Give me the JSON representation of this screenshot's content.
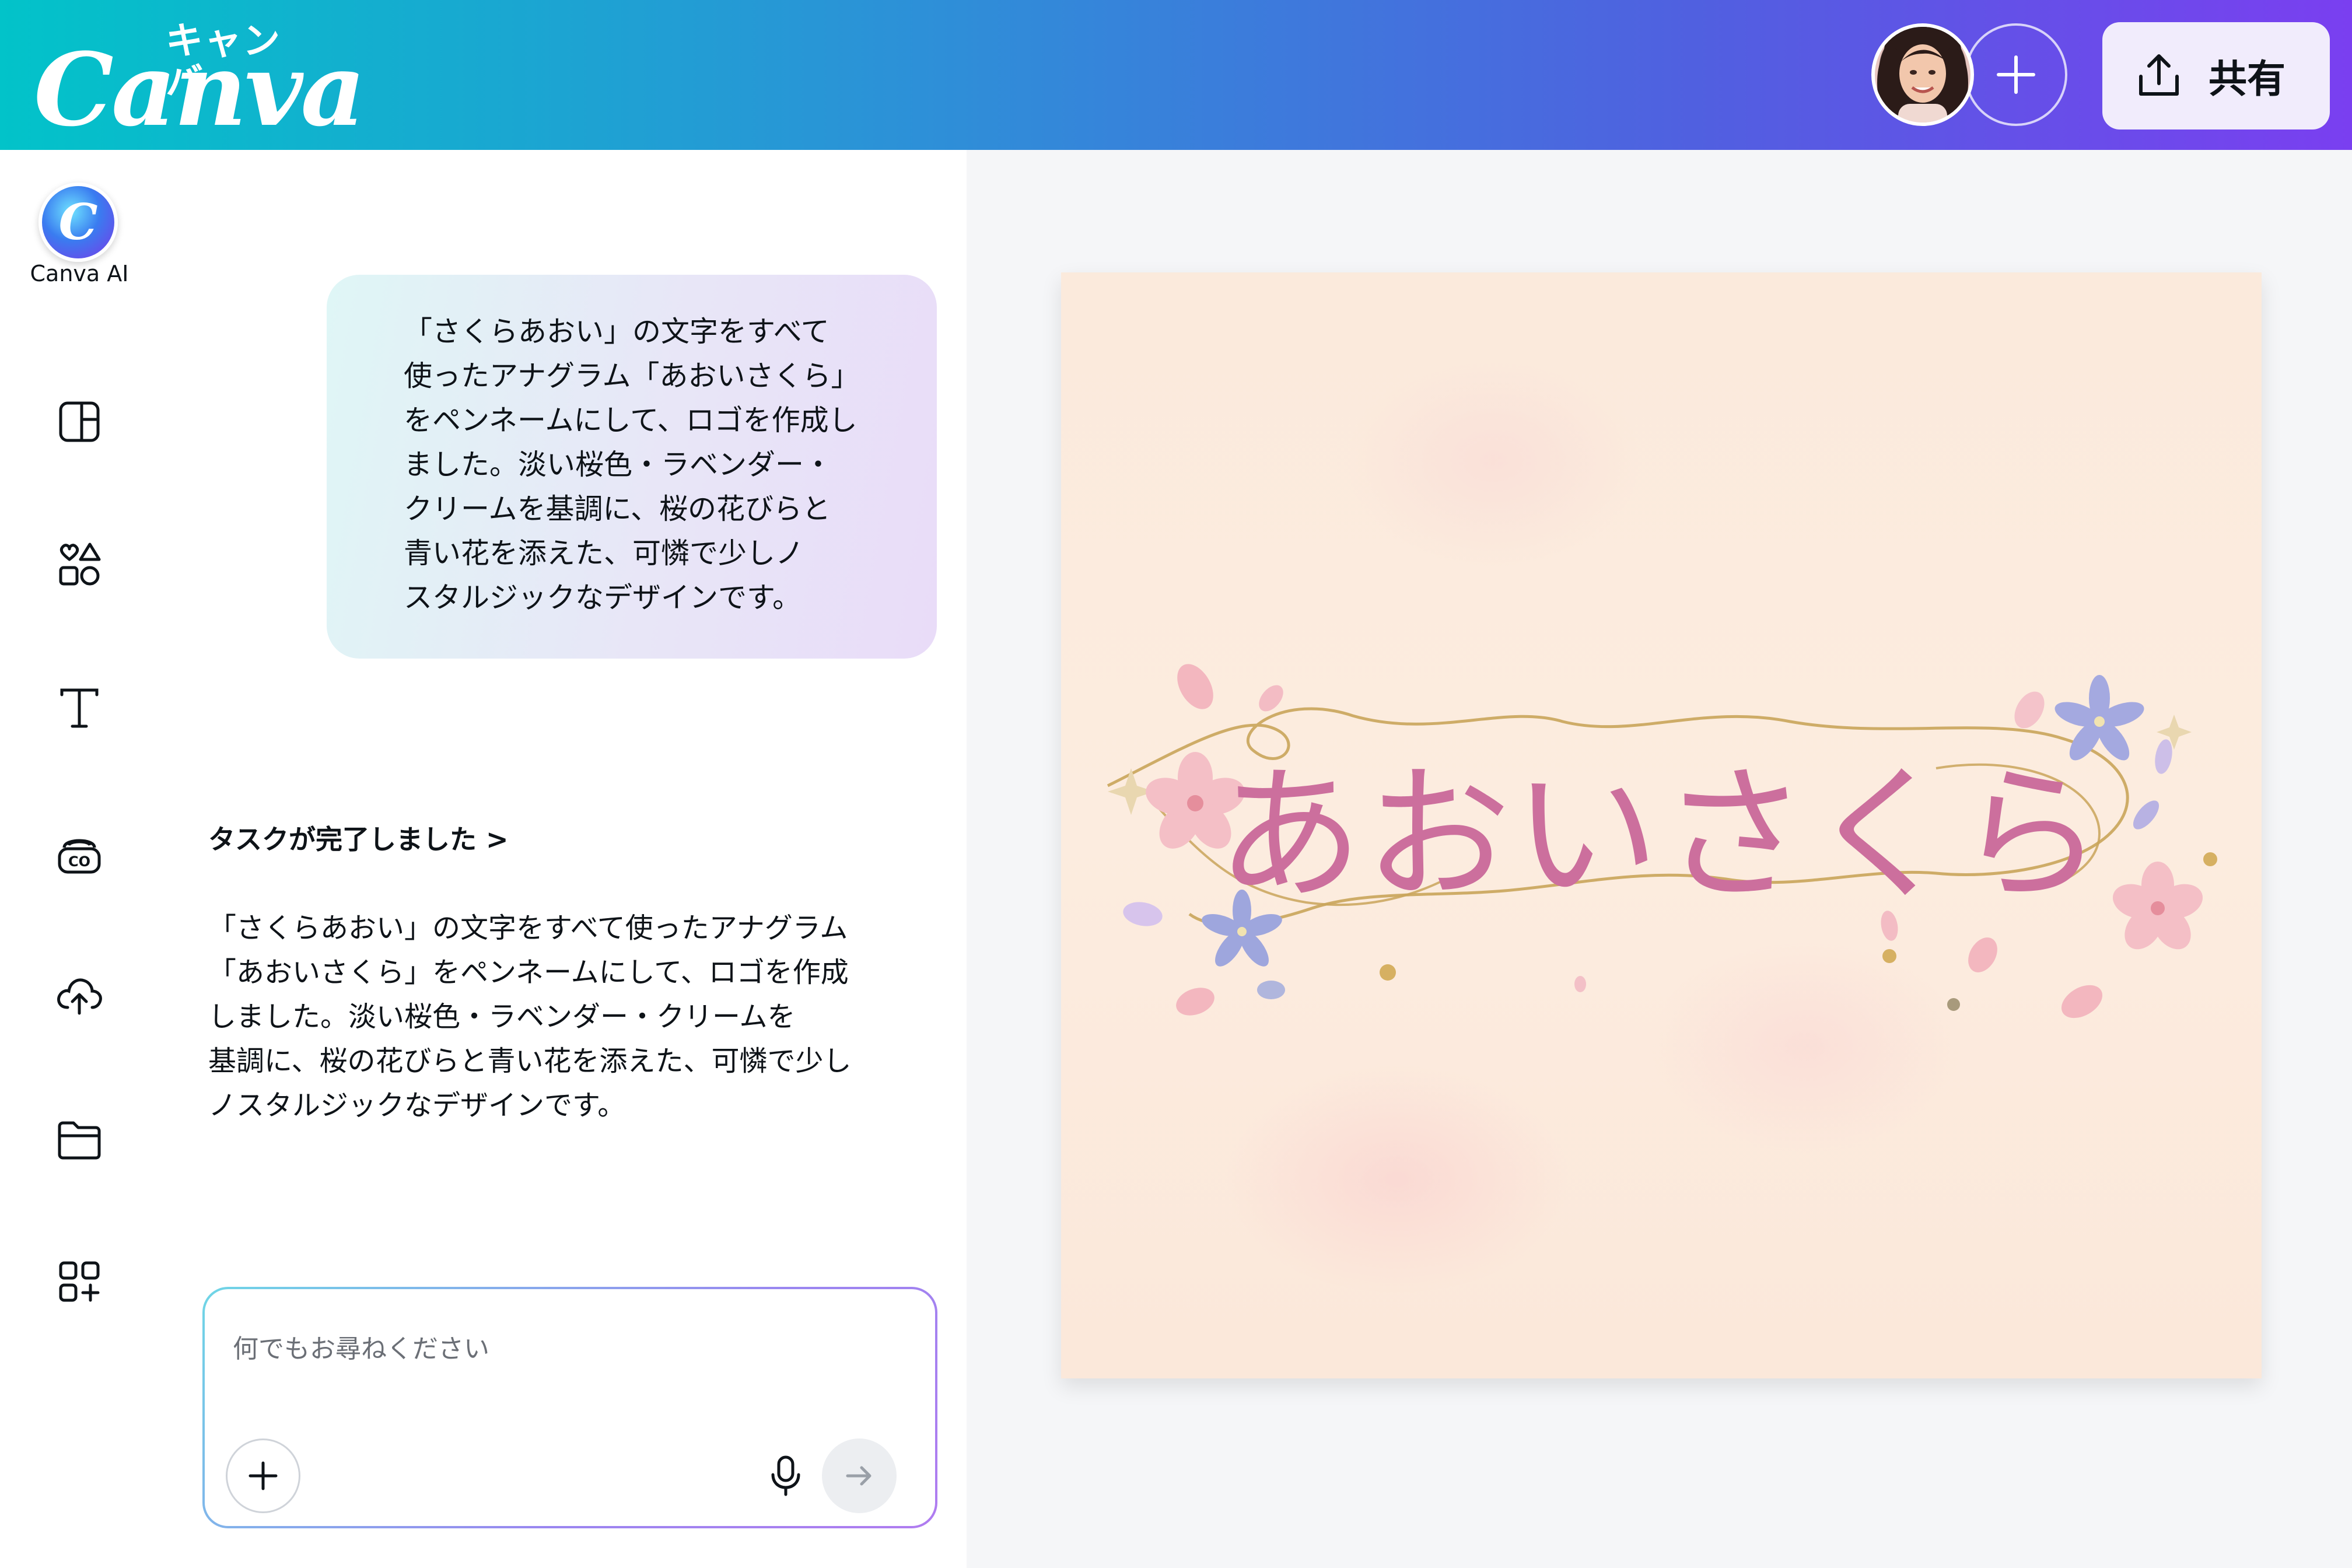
{
  "app": {
    "brand": "Canva",
    "brand_kana": "キャンバ",
    "share_label": "共有",
    "icons": {
      "avatar": "user-avatar",
      "add_collaborator": "plus-icon",
      "share": "upload-share-icon"
    },
    "colors": {
      "header_gradient_start": "#02c3c9",
      "header_gradient_end": "#7a3ff0",
      "title_pink": "#cc6f9d"
    }
  },
  "sidebar": {
    "ai_label": "Canva AI",
    "items": [
      {
        "icon": "design-panel-icon"
      },
      {
        "icon": "elements-icon"
      },
      {
        "icon": "text-icon"
      },
      {
        "icon": "brand-icon"
      },
      {
        "icon": "upload-cloud-icon"
      },
      {
        "icon": "folder-icon"
      },
      {
        "icon": "apps-icon"
      }
    ]
  },
  "chat": {
    "user_message": "「さくらあおい」の文字をすべて\n使ったアナグラム「あおいさくら」\nをペンネームにして、ロゴを作成し\nました。淡い桜色・ラベンダー・\nクリームを基調に、桜の花びらと\n青い花を添えた、可憐で少しノ\nスタルジックなデザインです。",
    "task_status": "タスクが完了しました >",
    "ai_reply": "「さくらあおい」の文字をすべて使ったアナグラム\n「あおいさくら」をペンネームにして、ロゴを作成\nしました。淡い桜色・ラベンダー・クリームを\n基調に、桜の花びらと青い花を添えた、可憐で少し\nノスタルジックなデザインです。",
    "input_placeholder": "何でもお尋ねください",
    "input_value": ""
  },
  "design": {
    "title": "あおいさくら"
  }
}
